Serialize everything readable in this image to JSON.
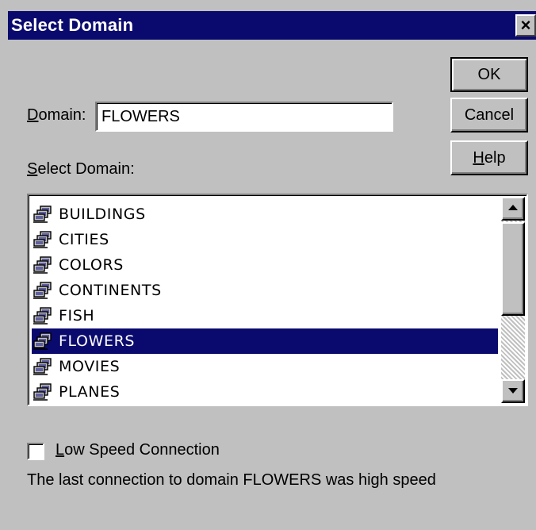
{
  "dialog": {
    "title": "Select Domain",
    "close_glyph": "×"
  },
  "buttons": {
    "ok": "OK",
    "cancel": "Cancel",
    "help_prefix": "",
    "help_mnemonic": "H",
    "help_rest": "elp"
  },
  "domain_field": {
    "label_mnemonic": "D",
    "label_rest": "omain:",
    "value": "FLOWERS"
  },
  "select_label": {
    "mnemonic": "S",
    "rest": "elect Domain:"
  },
  "domain_list": {
    "items": [
      {
        "label": "BUILDINGS"
      },
      {
        "label": "CITIES"
      },
      {
        "label": "COLORS"
      },
      {
        "label": "CONTINENTS"
      },
      {
        "label": "FISH"
      },
      {
        "label": "FLOWERS"
      },
      {
        "label": "MOVIES"
      },
      {
        "label": "PLANES"
      }
    ],
    "selected_label": "FLOWERS",
    "item_icon": "network-computer-icon"
  },
  "low_speed": {
    "checked": false,
    "label_mnemonic": "L",
    "label_rest": "ow Speed Connection"
  },
  "status": {
    "text": "The last connection to domain FLOWERS was high speed"
  },
  "colors": {
    "face": "#c0c0c0",
    "title_bar": "#0a0a6e",
    "selection": "#0a0a6e",
    "field_background": "#ffffff"
  }
}
